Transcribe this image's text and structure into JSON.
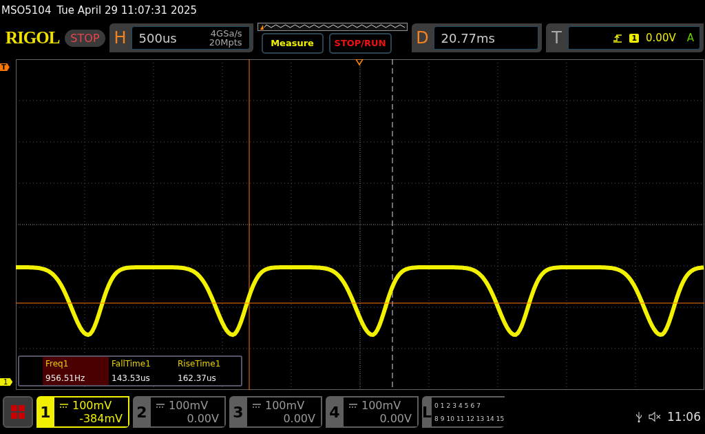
{
  "header": {
    "model": "MSO5104",
    "datetime": "Tue April 29 11:07:31 2025"
  },
  "toolbar": {
    "logo": "RIGOL",
    "run_state": "STOP",
    "horizontal": {
      "letter": "H",
      "timebase": "500us",
      "sample_rate": "4GSa/s",
      "memory_depth": "20Mpts"
    },
    "buttons": [
      {
        "label": "Measure",
        "kind": "measure"
      },
      {
        "label": "STOP/RUN",
        "kind": "stoprun"
      }
    ],
    "delay": {
      "letter": "D",
      "value": "20.77ms"
    },
    "trigger": {
      "letter": "T",
      "source": "1",
      "level": "0.00V",
      "mode": "A"
    }
  },
  "display": {
    "trigger_marker": "T",
    "channel_marker": "1"
  },
  "measurements": [
    {
      "name": "Freq1",
      "value": "956.51Hz",
      "selected": true
    },
    {
      "name": "FallTime1",
      "value": "143.53us",
      "selected": false
    },
    {
      "name": "RiseTime1",
      "value": "162.37us",
      "selected": false
    }
  ],
  "channels": [
    {
      "number": "1",
      "scale": "100mV",
      "offset": "-384mV",
      "selected": true
    },
    {
      "number": "2",
      "scale": "100mV",
      "offset": "0.00V",
      "selected": false
    },
    {
      "number": "3",
      "scale": "100mV",
      "offset": "0.00V",
      "selected": false
    },
    {
      "number": "4",
      "scale": "100mV",
      "offset": "0.00V",
      "selected": false
    }
  ],
  "logic": {
    "letter": "L",
    "bits_row_1": [
      "0",
      "1",
      "2",
      "3",
      "4",
      "5",
      "6",
      "7"
    ],
    "bits_row_2": [
      "8",
      "9",
      "10",
      "11",
      "12",
      "13",
      "14",
      "15"
    ]
  },
  "status": {
    "time": "11:06"
  }
}
